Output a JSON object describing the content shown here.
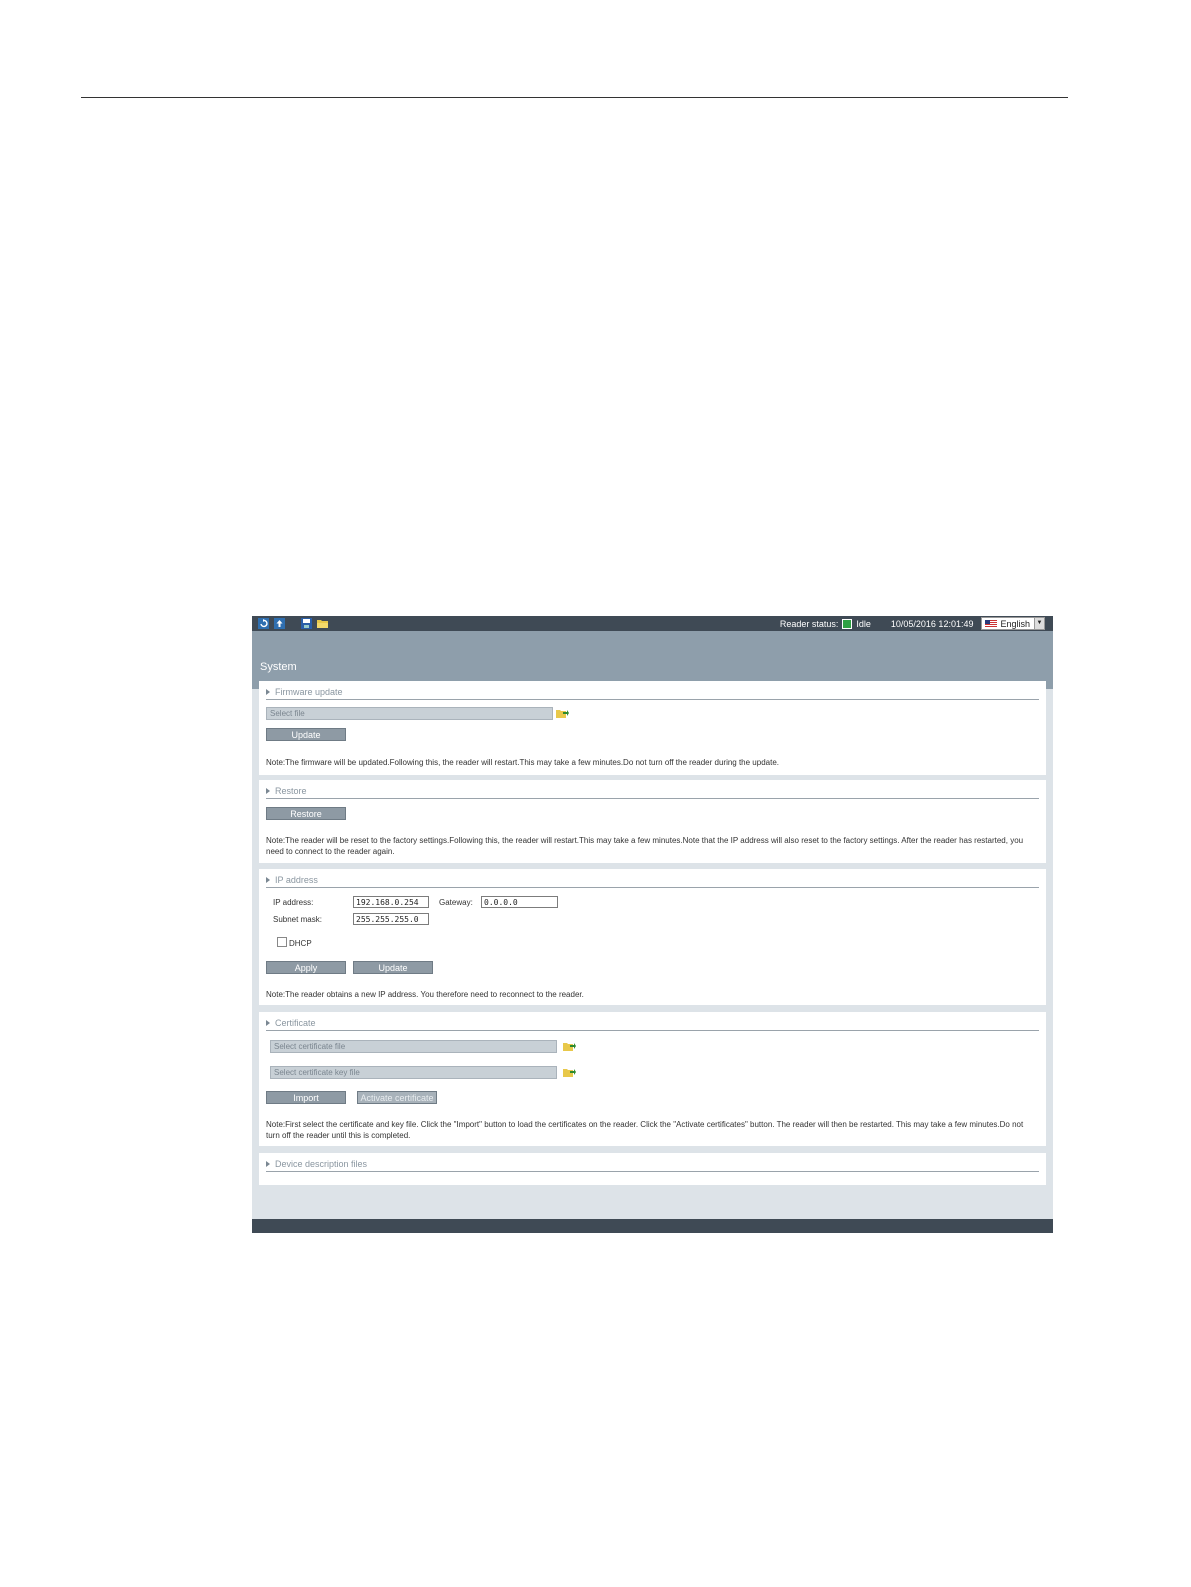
{
  "topbar": {
    "reader_status_label": "Reader status:",
    "status_value": "Idle",
    "status_color": "#2ea043",
    "datetime": "10/05/2016 12:01:49",
    "language": "English",
    "icons": [
      "refresh-icon",
      "upload-icon",
      "save-icon",
      "open-folder-icon"
    ]
  },
  "page": {
    "title": "System"
  },
  "firmware": {
    "heading": "Firmware update",
    "file_placeholder": "Select file",
    "update_label": "Update",
    "note": "Note:The firmware will be updated.Following this, the reader will restart.This may take a few minutes.Do not turn off the reader during the update."
  },
  "restore": {
    "heading": "Restore",
    "restore_label": "Restore",
    "note": "Note:The reader will be reset to the factory settings.Following this, the reader will restart.This may take a few minutes.Note that the IP address will also reset to the factory settings. After the reader has restarted, you need to connect to the reader again."
  },
  "ip": {
    "heading": "IP address",
    "ip_label": "IP address:",
    "ip_value": "192.168.0.254",
    "gateway_label": "Gateway:",
    "gateway_value": "0.0.0.0",
    "subnet_label": "Subnet mask:",
    "subnet_value": "255.255.255.0",
    "dhcp_label": "DHCP",
    "apply_label": "Apply",
    "update_label": "Update",
    "note": "Note:The reader obtains a new IP address. You therefore need to reconnect to the reader."
  },
  "certificate": {
    "heading": "Certificate",
    "cert_placeholder": "Select certificate file",
    "key_placeholder": "Select certificate key file",
    "import_label": "Import",
    "activate_label": "Activate certificate",
    "note": "Note:First select the certificate and key file. Click the \"Import\" button to load the certificates on the reader. Click the \"Activate certificates\" button. The reader will then be restarted. This may take a few minutes.Do not turn off the reader until this is completed."
  },
  "device_files": {
    "heading": "Device description files"
  }
}
